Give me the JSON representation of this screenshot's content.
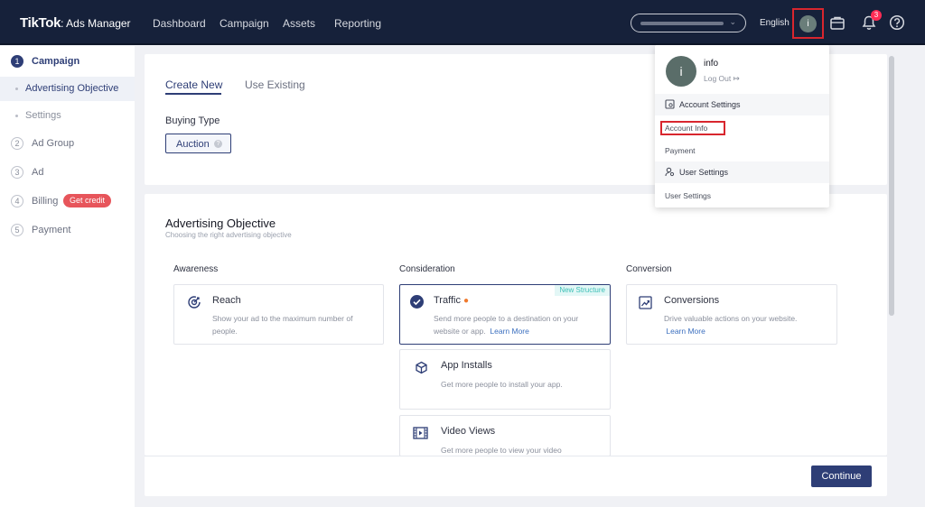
{
  "header": {
    "logo_brand": "TikTok",
    "logo_sub": ": Ads Manager",
    "nav": [
      "Dashboard",
      "Campaign",
      "Assets",
      "Reporting"
    ],
    "language": "English",
    "avatar_initial": "i",
    "notification_count": "3"
  },
  "sidebar": {
    "steps": [
      {
        "num": "1",
        "label": "Campaign"
      },
      {
        "num": "2",
        "label": "Ad Group"
      },
      {
        "num": "3",
        "label": "Ad"
      },
      {
        "num": "4",
        "label": "Billing"
      },
      {
        "num": "5",
        "label": "Payment"
      }
    ],
    "substeps": [
      "Advertising Objective",
      "Settings"
    ],
    "credit_badge": "Get credit"
  },
  "main": {
    "tabs": [
      "Create New",
      "Use Existing"
    ],
    "buying_type_label": "Buying Type",
    "buying_type_value": "Auction",
    "objective_title": "Advertising Objective",
    "objective_subtitle": "Choosing the right advertising objective",
    "columns": [
      "Awareness",
      "Consideration",
      "Conversion"
    ],
    "objectives": {
      "reach": {
        "title": "Reach",
        "desc": "Show your ad to the maximum number of people."
      },
      "traffic": {
        "title": "Traffic",
        "desc": "Send more people to a destination on your website or app.",
        "link": "Learn More",
        "badge": "New Structure"
      },
      "app_installs": {
        "title": "App Installs",
        "desc": "Get more people to install your app."
      },
      "video_views": {
        "title": "Video Views",
        "desc": "Get more people to view your video"
      },
      "conversions": {
        "title": "Conversions",
        "desc": "Drive valuable actions on your website.",
        "link": "Learn More"
      }
    },
    "continue_label": "Continue"
  },
  "dropdown": {
    "avatar_initial": "i",
    "name": "info",
    "logout": "Log Out",
    "account_settings": "Account Settings",
    "account_info": "Account Info",
    "payment": "Payment",
    "user_settings_header": "User Settings",
    "user_settings_item": "User Settings"
  },
  "colors": {
    "topbar": "#16213a",
    "primary": "#2e3e76",
    "highlight_box": "#d8262e",
    "credit_badge": "#e7555b"
  }
}
